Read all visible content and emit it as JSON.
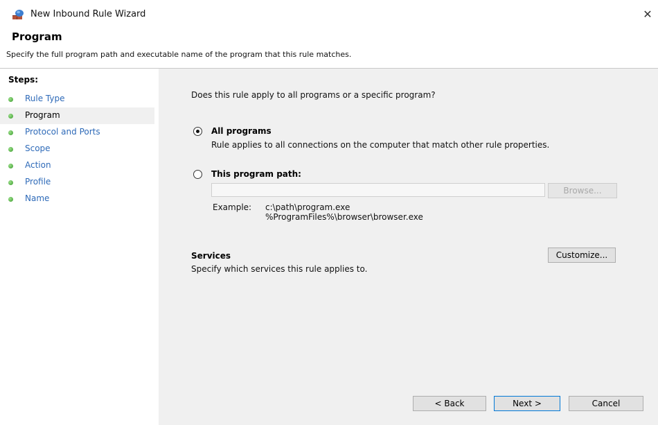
{
  "window": {
    "title": "New Inbound Rule Wizard",
    "close_glyph": "✕",
    "app_icon": "firewall-wizard-icon"
  },
  "header": {
    "title": "Program",
    "subtitle": "Specify the full program path and executable name of the program that this rule matches."
  },
  "sidebar": {
    "heading": "Steps:",
    "items": [
      {
        "label": "Rule Type"
      },
      {
        "label": "Program"
      },
      {
        "label": "Protocol and Ports"
      },
      {
        "label": "Scope"
      },
      {
        "label": "Action"
      },
      {
        "label": "Profile"
      },
      {
        "label": "Name"
      }
    ],
    "current_index": 1
  },
  "main": {
    "question": "Does this rule apply to all programs or a specific program?",
    "all_programs": {
      "label": "All programs",
      "description": "Rule applies to all connections on the computer that match other rule properties.",
      "selected": true
    },
    "program_path": {
      "label": "This program path:",
      "value": "",
      "selected": false,
      "browse_label": "Browse..."
    },
    "example": {
      "label": "Example:",
      "lines": [
        "c:\\path\\program.exe",
        "%ProgramFiles%\\browser\\browser.exe"
      ]
    },
    "services": {
      "title": "Services",
      "description": "Specify which services this rule applies to.",
      "customize_label": "Customize..."
    }
  },
  "footer": {
    "back_label": "< Back",
    "next_label": "Next >",
    "cancel_label": "Cancel"
  },
  "colors": {
    "link_blue": "#2e6ab8",
    "panel_gray": "#f0f0f0",
    "focus_blue": "#0078d7"
  }
}
